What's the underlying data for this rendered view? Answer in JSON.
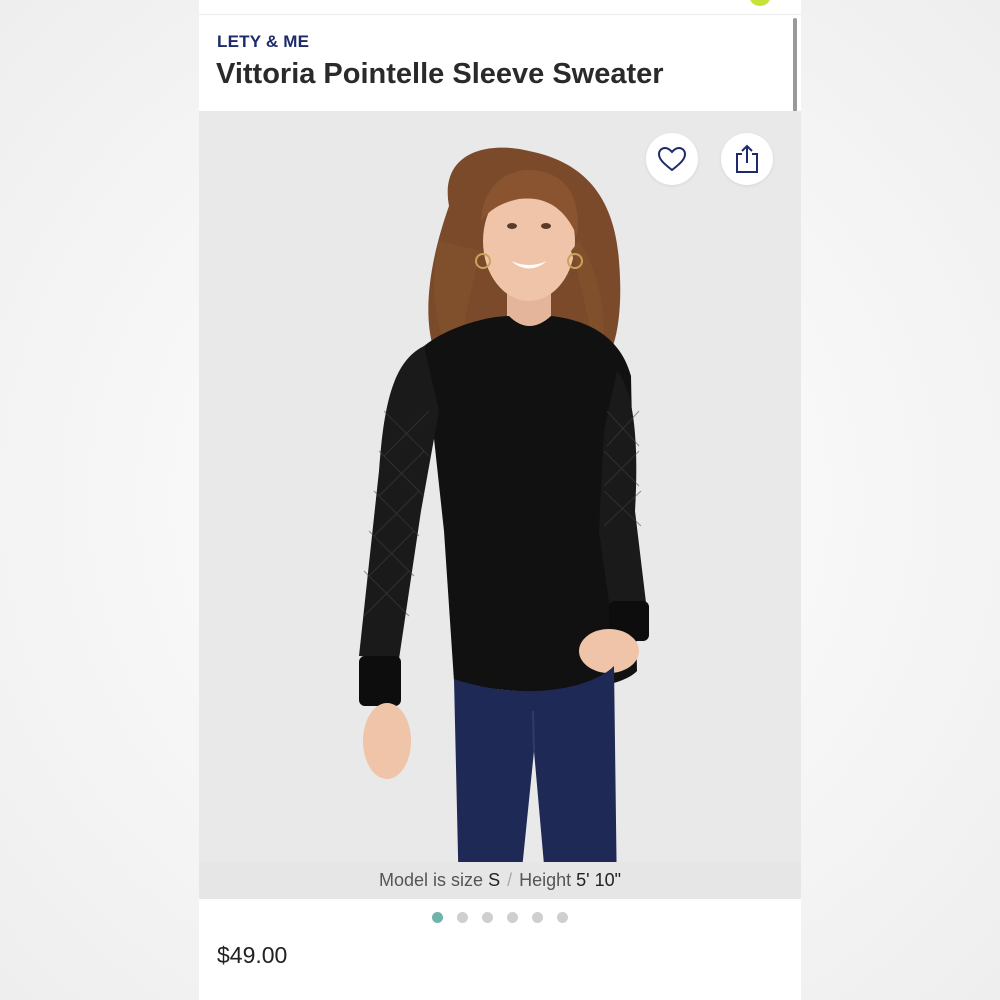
{
  "product": {
    "brand": "LETY & ME",
    "title": "Vittoria Pointelle Sleeve Sweater",
    "price": "$49.00"
  },
  "image": {
    "model_caption_prefix": "Model is size",
    "model_size": "S",
    "separator": "/",
    "height_label": "Height",
    "height_value": "5' 10\"",
    "carousel_total": 6,
    "carousel_active": 1
  },
  "actions": {
    "favorite_icon": "heart-icon",
    "share_icon": "share-icon"
  },
  "colors": {
    "brand": "#1d2b6b",
    "carousel_active": "#6fb3ad",
    "top_accent": "#c9e23a"
  }
}
